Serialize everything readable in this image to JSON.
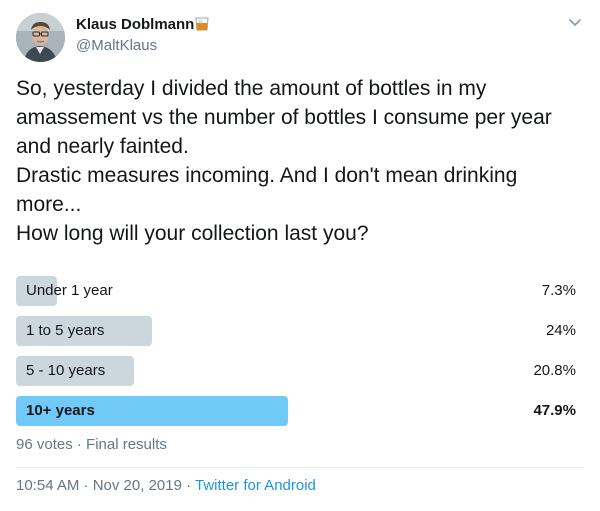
{
  "author": {
    "display_name": "Klaus Doblmann",
    "handle": "@MaltKlaus",
    "name_emoji": "whisky-tumbler-icon"
  },
  "header": {
    "menu_icon": "chevron-down-icon"
  },
  "tweet": {
    "lines": [
      "So, yesterday I divided the amount of bottles in my",
      "amassement  vs the number of bottles I consume per year",
      "and nearly fainted.",
      "Drastic measures incoming. And I don't mean drinking",
      "more...",
      "How long will your collection last you?"
    ]
  },
  "poll": {
    "options": [
      {
        "label": "Under 1 year",
        "percent_text": "7.3%",
        "percent": 7.3
      },
      {
        "label": "1 to 5 years",
        "percent_text": "24%",
        "percent": 24
      },
      {
        "label": "5 - 10 years",
        "percent_text": "20.8%",
        "percent": 20.8
      },
      {
        "label": "10+ years",
        "percent_text": "47.9%",
        "percent": 47.9
      }
    ],
    "winner_index": 3,
    "votes_summary": "96 votes · Final results"
  },
  "meta": {
    "timestamp": "10:54 AM · Nov 20, 2019 · ",
    "source": "Twitter for Android"
  },
  "colors": {
    "bar": "#ccd6dd",
    "winner_bar": "#71c9f8",
    "link": "#1b95e0",
    "secondary_text": "#657786"
  }
}
